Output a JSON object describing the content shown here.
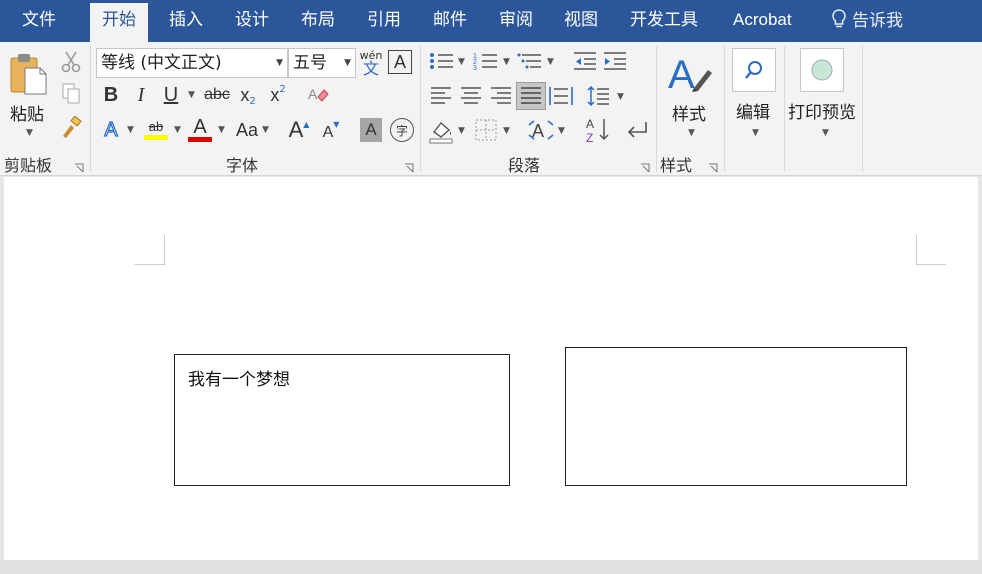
{
  "menu": {
    "tabs": [
      {
        "label": "文件",
        "active": false
      },
      {
        "label": "开始",
        "active": true
      },
      {
        "label": "插入",
        "active": false
      },
      {
        "label": "设计",
        "active": false
      },
      {
        "label": "布局",
        "active": false
      },
      {
        "label": "引用",
        "active": false
      },
      {
        "label": "邮件",
        "active": false
      },
      {
        "label": "审阅",
        "active": false
      },
      {
        "label": "视图",
        "active": false
      },
      {
        "label": "开发工具",
        "active": false
      },
      {
        "label": "Acrobat",
        "active": false
      }
    ],
    "tell_me": "告诉我"
  },
  "ribbon": {
    "clipboard": {
      "paste_label": "粘贴",
      "group_label": "剪贴板"
    },
    "font": {
      "font_name": "等线 (中文正文)",
      "font_size": "五号",
      "phonetic_top": "wén",
      "phonetic_bottom": "文",
      "border_char": "A",
      "bold": "B",
      "italic": "I",
      "underline": "U",
      "strike": "abc",
      "subscript": "x",
      "subscript_mark": "2",
      "superscript": "x",
      "superscript_mark": "2",
      "text_effect": "A",
      "highlight": "ab",
      "font_color": "A",
      "change_case": "Aa",
      "grow": "A",
      "shrink": "A",
      "shading_char": "A",
      "enclose_char": "字",
      "group_label": "字体",
      "highlight_color": "#ffff00",
      "font_color_value": "#e00000"
    },
    "paragraph": {
      "group_label": "段落"
    },
    "styles": {
      "styles_label": "样式",
      "group_label": "样式"
    },
    "editing": {
      "label": "编辑"
    },
    "print_preview": {
      "label": "打印预览"
    }
  },
  "document": {
    "textbox1": {
      "text": "我有一个梦想"
    },
    "textbox2": {
      "text": ""
    }
  },
  "colors": {
    "accent": "#2b579a",
    "ribbon_bg": "#f3f3f3"
  }
}
